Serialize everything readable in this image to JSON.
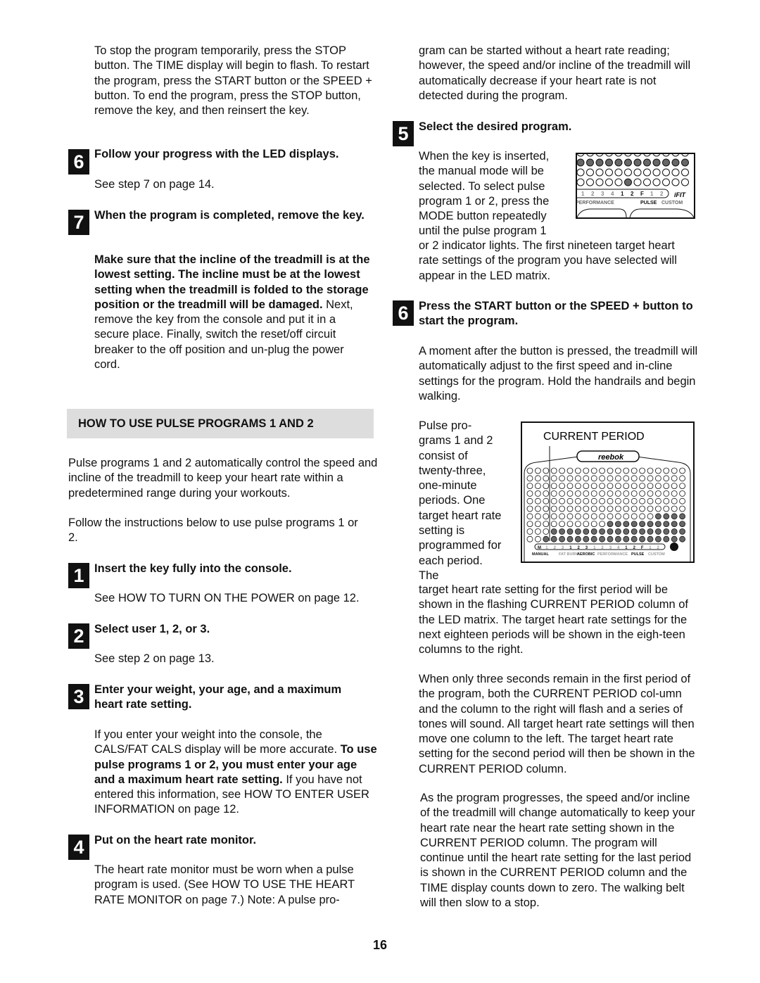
{
  "left": {
    "intro": "To stop the program temporarily, press the STOP button. The TIME display will begin to flash. To restart the program, press the START button or the SPEED + button. To end the program, press the STOP button, remove the key, and then reinsert the key.",
    "step6": {
      "num": "6",
      "title": "Follow your progress with the LED displays.",
      "body": "See step 7 on page 14."
    },
    "step7": {
      "num": "7",
      "title": "When the program is completed, remove the key.",
      "warn": "Make sure that the incline of the treadmill is at the lowest setting. The incline must be at the lowest setting when the treadmill is folded to the storage position or the treadmill will be damaged.",
      "body": " Next, remove the key from the console and put it in a secure place. Finally, switch the reset/off circuit breaker to the off position and un-plug the power cord."
    },
    "section_title": "HOW TO USE PULSE PROGRAMS 1 AND 2",
    "p1": "Pulse programs 1 and 2 automatically control the speed and incline of the treadmill to keep your heart rate within a predetermined range during your workouts.",
    "p2": "Follow the instructions below to use pulse programs 1 or 2.",
    "s1": {
      "num": "1",
      "title": "Insert the key fully into the console.",
      "body": "See HOW TO TURN ON THE POWER on page 12."
    },
    "s2": {
      "num": "2",
      "title": "Select user 1, 2, or 3.",
      "body": "See step 2 on page 13."
    },
    "s3": {
      "num": "3",
      "title": "Enter your weight, your age, and a maximum heart rate setting.",
      "body1": "If you enter your weight into the console, the CALS/FAT CALS display will be more accurate. ",
      "bold": "To use pulse programs 1 or 2, you must enter your age and a maximum heart rate setting.",
      "body2": " If you have not entered this information, see HOW TO ENTER USER INFORMATION on page 12."
    },
    "s4": {
      "num": "4",
      "title": "Put on the heart rate monitor.",
      "body": "The heart rate monitor must be worn when a pulse program is used. (See HOW TO USE THE HEART RATE MONITOR on page 7.) Note: A pulse pro-"
    }
  },
  "right": {
    "cont": "gram can be started without a heart rate reading; however, the speed and/or incline of the treadmill will automatically decrease if your heart rate is not detected during the program.",
    "s5": {
      "num": "5",
      "title": "Select the desired program.",
      "body_a": "When the key is inserted, the manual mode will be selected. To select pulse program 1 or 2, press the MODE button repeatedly until the pulse program 1",
      "body_b": "or 2 indicator lights. The first nineteen target heart rate settings of the program you have selected will appear in the LED matrix."
    },
    "s6": {
      "num": "6",
      "title": "Press the START button or the SPEED + button to start the program.",
      "body": "A moment after the button is pressed, the treadmill will automatically adjust to the first speed and in-cline settings for the program. Hold the handrails and begin walking."
    },
    "p_a": "Pulse pro- grams 1 and 2 consist of twenty-three, one-minute periods. One target heart rate setting is programmed for each period. The",
    "p_b": "target heart rate setting for the first period will be shown in the flashing CURRENT PERIOD column of the LED matrix. The target heart rate settings for the next eighteen periods will be shown in the eigh-teen columns to the right.",
    "p3": "When only three seconds remain in the first period of the program, both the CURRENT PERIOD col-umn and the column to the right will flash and a series of tones will sound. All target heart rate settings will then move one column to the left. The target heart rate setting for the second period will then be shown in the CURRENT PERIOD column.",
    "p4": "As the program progresses, the speed and/or incline of the treadmill will change automatically to keep your heart rate near the heart rate setting shown in the CURRENT PERIOD column. The program will continue until the heart rate setting for the last period is shown in the CURRENT PERIOD column and the TIME display counts down to zero. The walking belt will then slow to a stop."
  },
  "fig1": {
    "labels": [
      "1",
      "2",
      "3",
      "4",
      "1",
      "2",
      "F",
      "1",
      "2"
    ],
    "groups": [
      "PERFORMANCE",
      "PULSE",
      "CUSTOM"
    ],
    "logo": "iFIT.com interactive"
  },
  "fig2": {
    "label": "CURRENT PERIOD",
    "brand": "reebok",
    "rows": 10,
    "target_levels": [
      0,
      0,
      1,
      2,
      2,
      2,
      2,
      2,
      2,
      2,
      3,
      3,
      3,
      3,
      3,
      3,
      4,
      4,
      4,
      4
    ],
    "labels": [
      "M",
      "1",
      "2",
      "3",
      "1",
      "2",
      "3",
      "1",
      "2",
      "3",
      "4",
      "1",
      "2",
      "F",
      "1",
      "2"
    ],
    "groups": [
      "MANUAL",
      "FAT BURN",
      "AEROBIC",
      "PERFORMANCE",
      "PULSE",
      "CUSTOM"
    ]
  },
  "page_number": "16",
  "colors": {
    "led_on": "#666666",
    "badge": "#111111",
    "section_bg": "#dddddd"
  }
}
